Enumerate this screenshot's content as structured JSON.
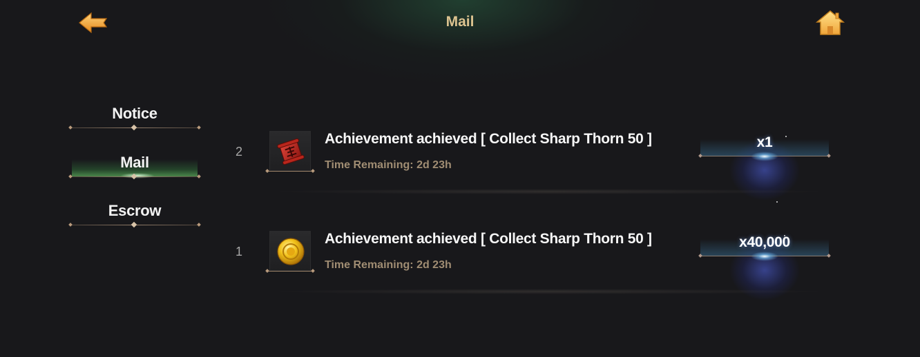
{
  "header": {
    "title": "Mail",
    "back_icon": "back-arrow-icon",
    "home_icon": "home-icon"
  },
  "tabs": [
    {
      "label": "Notice",
      "active": false
    },
    {
      "label": "Mail",
      "active": true
    },
    {
      "label": "Escrow",
      "active": false
    }
  ],
  "mails": [
    {
      "index": "2",
      "icon": "scroll-icon",
      "title": "Achievement achieved [ Collect Sharp Thorn 50 ]",
      "time_remaining": "Time Remaining: 2d 23h",
      "reward_amount": "x1"
    },
    {
      "index": "1",
      "icon": "gold-coin-icon",
      "title": "Achievement achieved [ Collect Sharp Thorn 50 ]",
      "time_remaining": "Time Remaining: 2d 23h",
      "reward_amount": "x40,000"
    }
  ],
  "colors": {
    "background": "#18181b",
    "title_gold": "#dcc390",
    "time_text": "#a08d73",
    "active_tab_glow": "#5aaa5a",
    "reward_glow": "#5064e6"
  }
}
